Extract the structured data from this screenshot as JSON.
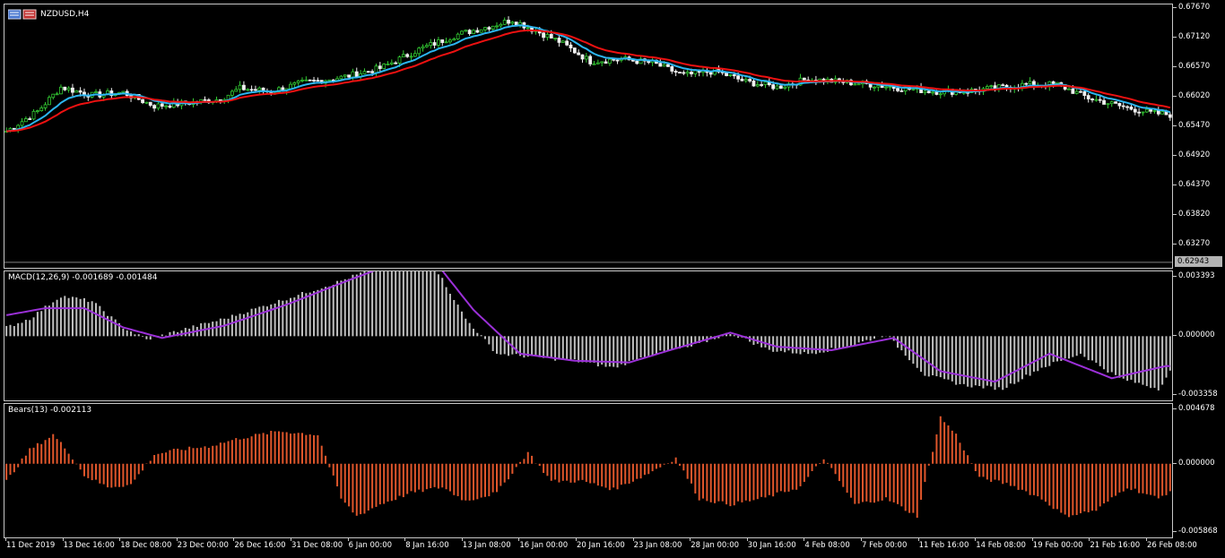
{
  "window": {
    "symbol_label": "NZDUSD,H4",
    "icon": "chart-window-icons"
  },
  "colors": {
    "background": "#000000",
    "bull_candle": "#33cc33",
    "bear_candle": "#f0f0f0",
    "ma_fast": "#2cb5f0",
    "ma_slow": "#ee1111",
    "macd_hist": "#c0c0c0",
    "macd_signal": "#9b30d8",
    "bears_hist": "#e0562b",
    "current_price_badge": "#b4b4b4"
  },
  "chart_data": [
    {
      "type": "candlestick",
      "symbol": "NZDUSD,H4",
      "bar_count": 300,
      "ylim": [
        0.6294,
        0.6767
      ],
      "y_ticks": [
        "0.67670",
        "0.67120",
        "0.66570",
        "0.66020",
        "0.65470",
        "0.64920",
        "0.64370",
        "0.63820",
        "0.63270"
      ],
      "current_price": "0.62943",
      "close_anchors": [
        [
          0,
          0.6538
        ],
        [
          8,
          0.6575
        ],
        [
          14,
          0.662
        ],
        [
          22,
          0.6605
        ],
        [
          30,
          0.661
        ],
        [
          38,
          0.6585
        ],
        [
          46,
          0.659
        ],
        [
          55,
          0.6598
        ],
        [
          60,
          0.6618
        ],
        [
          68,
          0.6612
        ],
        [
          76,
          0.6628
        ],
        [
          86,
          0.6638
        ],
        [
          96,
          0.6655
        ],
        [
          106,
          0.669
        ],
        [
          116,
          0.6718
        ],
        [
          124,
          0.6733
        ],
        [
          130,
          0.6745
        ],
        [
          136,
          0.6725
        ],
        [
          142,
          0.6705
        ],
        [
          150,
          0.6668
        ],
        [
          158,
          0.6672
        ],
        [
          166,
          0.6665
        ],
        [
          174,
          0.6642
        ],
        [
          182,
          0.665
        ],
        [
          190,
          0.663
        ],
        [
          198,
          0.662
        ],
        [
          206,
          0.6635
        ],
        [
          214,
          0.663
        ],
        [
          222,
          0.6625
        ],
        [
          230,
          0.6618
        ],
        [
          238,
          0.6612
        ],
        [
          246,
          0.6612
        ],
        [
          254,
          0.6618
        ],
        [
          262,
          0.6625
        ],
        [
          270,
          0.6625
        ],
        [
          278,
          0.66
        ],
        [
          286,
          0.6585
        ],
        [
          294,
          0.6572
        ],
        [
          300,
          0.6568
        ]
      ],
      "series": [
        {
          "name": "",
          "kind": "moving-average-fast",
          "color": "#2cb5f0"
        },
        {
          "name": "",
          "kind": "moving-average-slow",
          "color": "#ee1111"
        }
      ]
    },
    {
      "type": "bar",
      "title": "MACD(12,26,9) -0.001689 -0.001484",
      "ylim": [
        -0.003358,
        0.003393
      ],
      "y_ticks": [
        "0.003393",
        "0.000000",
        "-0.003358"
      ],
      "histogram_anchors": [
        [
          0,
          0.0005
        ],
        [
          6,
          0.001
        ],
        [
          14,
          0.0023
        ],
        [
          22,
          0.002
        ],
        [
          30,
          0.0005
        ],
        [
          36,
          -0.0002
        ],
        [
          44,
          0.0003
        ],
        [
          56,
          0.001
        ],
        [
          70,
          0.002
        ],
        [
          84,
          0.003
        ],
        [
          96,
          0.004
        ],
        [
          104,
          0.0045
        ],
        [
          110,
          0.004
        ],
        [
          118,
          0.001
        ],
        [
          126,
          -0.001
        ],
        [
          136,
          -0.0012
        ],
        [
          146,
          -0.0014
        ],
        [
          156,
          -0.0018
        ],
        [
          166,
          -0.001
        ],
        [
          176,
          -0.0006
        ],
        [
          186,
          0.0002
        ],
        [
          196,
          -0.0008
        ],
        [
          206,
          -0.001
        ],
        [
          216,
          -0.0006
        ],
        [
          226,
          0.0001
        ],
        [
          236,
          -0.0022
        ],
        [
          246,
          -0.0028
        ],
        [
          256,
          -0.003
        ],
        [
          266,
          -0.0018
        ],
        [
          276,
          -0.001
        ],
        [
          286,
          -0.0024
        ],
        [
          296,
          -0.003
        ],
        [
          300,
          -0.0017
        ]
      ],
      "signal_anchors": [
        [
          0,
          0.0012
        ],
        [
          10,
          0.0016
        ],
        [
          20,
          0.0016
        ],
        [
          30,
          0.0005
        ],
        [
          40,
          -0.0001
        ],
        [
          56,
          0.0006
        ],
        [
          72,
          0.0018
        ],
        [
          88,
          0.0032
        ],
        [
          100,
          0.0042
        ],
        [
          110,
          0.0043
        ],
        [
          120,
          0.0015
        ],
        [
          132,
          -0.001
        ],
        [
          146,
          -0.0014
        ],
        [
          160,
          -0.0015
        ],
        [
          172,
          -0.0007
        ],
        [
          186,
          0.0002
        ],
        [
          198,
          -0.0006
        ],
        [
          212,
          -0.0008
        ],
        [
          228,
          -0.0001
        ],
        [
          240,
          -0.002
        ],
        [
          254,
          -0.0026
        ],
        [
          268,
          -0.001
        ],
        [
          284,
          -0.0024
        ],
        [
          298,
          -0.0017
        ]
      ]
    },
    {
      "type": "bar",
      "title": "Bears(13) -0.002113",
      "ylim": [
        -0.005868,
        0.004678
      ],
      "y_ticks": [
        "0.004678",
        "0.000000",
        "-0.005868"
      ],
      "histogram_anchors": [
        [
          0,
          -0.0015
        ],
        [
          6,
          0.0012
        ],
        [
          12,
          0.0025
        ],
        [
          16,
          0.001
        ],
        [
          20,
          -0.001
        ],
        [
          26,
          -0.002
        ],
        [
          32,
          -0.0018
        ],
        [
          38,
          0.0008
        ],
        [
          44,
          0.0012
        ],
        [
          52,
          0.0015
        ],
        [
          60,
          0.0022
        ],
        [
          70,
          0.0028
        ],
        [
          80,
          0.0025
        ],
        [
          86,
          -0.003
        ],
        [
          90,
          -0.0045
        ],
        [
          96,
          -0.0035
        ],
        [
          104,
          -0.0025
        ],
        [
          112,
          -0.002
        ],
        [
          118,
          -0.0032
        ],
        [
          126,
          -0.0025
        ],
        [
          134,
          0.001
        ],
        [
          140,
          -0.0015
        ],
        [
          148,
          -0.0015
        ],
        [
          156,
          -0.0022
        ],
        [
          164,
          -0.001
        ],
        [
          172,
          0.0005
        ],
        [
          178,
          -0.003
        ],
        [
          186,
          -0.0035
        ],
        [
          194,
          -0.003
        ],
        [
          204,
          -0.002
        ],
        [
          210,
          0.0005
        ],
        [
          218,
          -0.0035
        ],
        [
          226,
          -0.003
        ],
        [
          234,
          -0.0045
        ],
        [
          240,
          0.004
        ],
        [
          244,
          0.0025
        ],
        [
          250,
          -0.0012
        ],
        [
          258,
          -0.0018
        ],
        [
          266,
          -0.003
        ],
        [
          272,
          -0.0045
        ],
        [
          280,
          -0.004
        ],
        [
          288,
          -0.002
        ],
        [
          296,
          -0.003
        ],
        [
          300,
          -0.0021
        ]
      ]
    }
  ],
  "time_axis": {
    "labels": [
      "11 Dec 2019",
      "13 Dec 16:00",
      "18 Dec 08:00",
      "23 Dec 00:00",
      "26 Dec 16:00",
      "31 Dec 08:00",
      "6 Jan 00:00",
      "8 Jan 16:00",
      "13 Jan 08:00",
      "16 Jan 00:00",
      "20 Jan 16:00",
      "23 Jan 08:00",
      "28 Jan 00:00",
      "30 Jan 16:00",
      "4 Feb 08:00",
      "7 Feb 00:00",
      "11 Feb 16:00",
      "14 Feb 08:00",
      "19 Feb 00:00",
      "21 Feb 16:00",
      "26 Feb 08:00"
    ]
  }
}
